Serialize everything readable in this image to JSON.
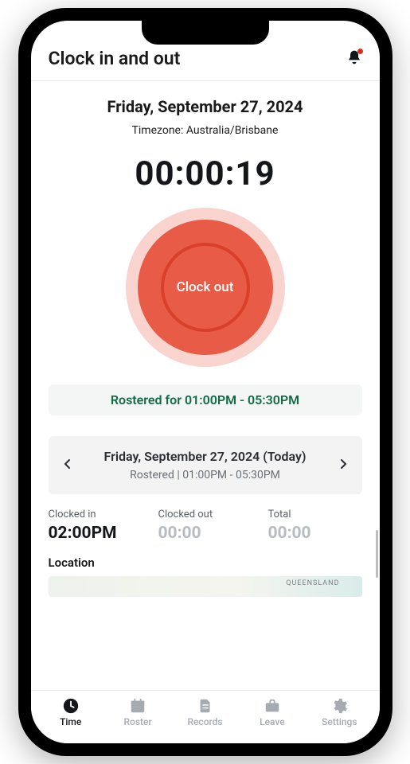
{
  "header": {
    "title": "Clock in and out"
  },
  "main": {
    "date_heading": "Friday, September 27, 2024",
    "timezone_text": "Timezone: Australia/Brisbane",
    "timer": "00:00:19",
    "clock_button_label": "Clock out",
    "roster_badge": "Rostered for 01:00PM - 05:30PM"
  },
  "day_nav": {
    "title": "Friday, September 27, 2024 (Today)",
    "subtitle": "Rostered | 01:00PM - 05:30PM"
  },
  "stats": {
    "clocked_in_label": "Clocked in",
    "clocked_in_value": "02:00PM",
    "clocked_out_label": "Clocked out",
    "clocked_out_value": "00:00",
    "total_label": "Total",
    "total_value": "00:00"
  },
  "location": {
    "label": "Location",
    "map_region": "QUEENSLAND"
  },
  "tabs": {
    "time": "Time",
    "roster": "Roster",
    "records": "Records",
    "leave": "Leave",
    "settings": "Settings"
  }
}
